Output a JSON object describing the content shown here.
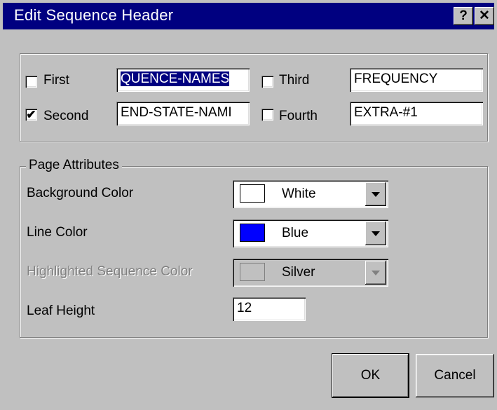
{
  "window": {
    "title": "Edit Sequence Header",
    "help_label": "?",
    "close_label": "✕"
  },
  "sequence_fields": {
    "first": {
      "label": "First",
      "checked": false,
      "value": "QUENCE-NAMES"
    },
    "second": {
      "label": "Second",
      "checked": true,
      "value": "END-STATE-NAMI"
    },
    "third": {
      "label": "Third",
      "checked": false,
      "value": "FREQUENCY"
    },
    "fourth": {
      "label": "Fourth",
      "checked": false,
      "value": "EXTRA-#1"
    }
  },
  "page_attributes": {
    "legend": "Page Attributes",
    "background_color": {
      "label": "Background Color",
      "value": "White",
      "swatch": "#ffffff"
    },
    "line_color": {
      "label": "Line Color",
      "value": "Blue",
      "swatch": "#0000ff"
    },
    "highlighted_color": {
      "label": "Highlighted Sequence Color",
      "value": "Silver",
      "swatch": "#c0c0c0",
      "enabled": false
    },
    "leaf_height": {
      "label": "Leaf Height",
      "value": "12"
    }
  },
  "buttons": {
    "ok": "OK",
    "cancel": "Cancel"
  },
  "colors": {
    "titlebar": "#000080",
    "face": "#c0c0c0"
  }
}
